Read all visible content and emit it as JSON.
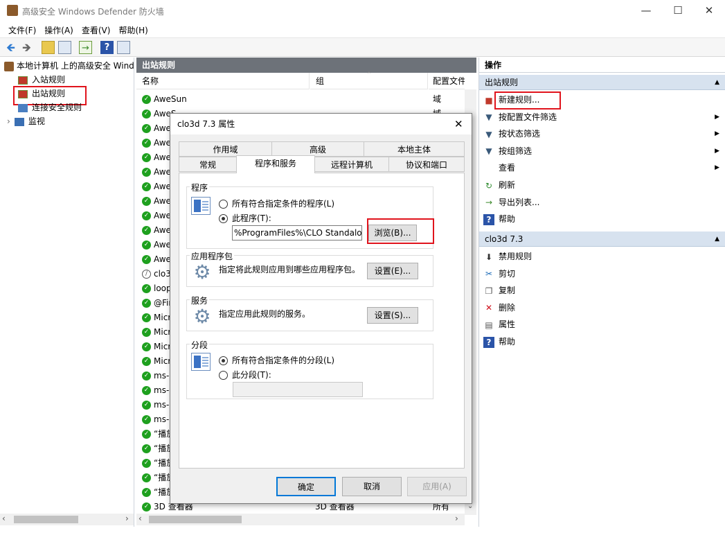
{
  "window": {
    "title": "高级安全 Windows Defender 防火墙"
  },
  "menu": [
    "文件(F)",
    "操作(A)",
    "查看(V)",
    "帮助(H)"
  ],
  "tree": {
    "root": "本地计算机 上的高级安全 Wind",
    "items": [
      "入站规则",
      "出站规则",
      "连接安全规则",
      "监视"
    ]
  },
  "middle": {
    "header": "出站规则",
    "columns": [
      "名称",
      "组",
      "配置文件"
    ],
    "rows": [
      {
        "name": "AweSun",
        "group": "",
        "profile": "域",
        "enabled": true
      },
      {
        "name": "AweS",
        "group": "",
        "profile": "域",
        "enabled": true
      },
      {
        "name": "Awe",
        "group": "",
        "profile": "",
        "enabled": true
      },
      {
        "name": "Awe",
        "group": "",
        "profile": "",
        "enabled": true
      },
      {
        "name": "Awe",
        "group": "",
        "profile": "",
        "enabled": true
      },
      {
        "name": "Awe",
        "group": "",
        "profile": "",
        "enabled": true
      },
      {
        "name": "Awe",
        "group": "",
        "profile": "",
        "enabled": true
      },
      {
        "name": "Awe",
        "group": "",
        "profile": "",
        "enabled": true
      },
      {
        "name": "Awe",
        "group": "",
        "profile": "",
        "enabled": true
      },
      {
        "name": "Awe",
        "group": "",
        "profile": "",
        "enabled": true
      },
      {
        "name": "Awe",
        "group": "",
        "profile": "",
        "enabled": true
      },
      {
        "name": "Awe",
        "group": "",
        "profile": "",
        "enabled": true
      },
      {
        "name": "clo3",
        "group": "",
        "profile": "",
        "enabled": false
      },
      {
        "name": "loop",
        "group": "",
        "profile": "",
        "enabled": true
      },
      {
        "name": "@Fir",
        "group": "",
        "profile": "",
        "enabled": true
      },
      {
        "name": "Micr",
        "group": "",
        "profile": "",
        "enabled": true
      },
      {
        "name": "Micr",
        "group": "",
        "profile": "",
        "enabled": true
      },
      {
        "name": "Micr",
        "group": "",
        "profile": "",
        "enabled": true
      },
      {
        "name": "Micr",
        "group": "",
        "profile": "",
        "enabled": true
      },
      {
        "name": "ms-r",
        "group": "",
        "profile": "",
        "enabled": true
      },
      {
        "name": "ms-r",
        "group": "",
        "profile": "",
        "enabled": true
      },
      {
        "name": "ms-r",
        "group": "",
        "profile": "",
        "enabled": true
      },
      {
        "name": "ms-r",
        "group": "",
        "profile": "",
        "enabled": true
      },
      {
        "name": "“播放",
        "group": "",
        "profile": "",
        "enabled": true
      },
      {
        "name": "“播放",
        "group": "",
        "profile": "",
        "enabled": true
      },
      {
        "name": "“播放",
        "group": "",
        "profile": "",
        "enabled": true
      },
      {
        "name": "“播放",
        "group": "",
        "profile": "",
        "enabled": true
      },
      {
        "name": "“播放",
        "group": "",
        "profile": "",
        "enabled": true
      },
      {
        "name": "3D 查看器",
        "group": "3D 查看器",
        "profile": "所有",
        "enabled": true
      }
    ]
  },
  "actions": {
    "header": "操作",
    "section1": {
      "title": "出站规则",
      "items": [
        {
          "label": "新建规则...",
          "icon": "new-rule-icon",
          "submenu": false
        },
        {
          "label": "按配置文件筛选",
          "icon": "filter-icon",
          "submenu": true
        },
        {
          "label": "按状态筛选",
          "icon": "filter-icon",
          "submenu": true
        },
        {
          "label": "按组筛选",
          "icon": "filter-icon",
          "submenu": true
        },
        {
          "label": "查看",
          "icon": "",
          "submenu": true
        },
        {
          "label": "刷新",
          "icon": "refresh-icon",
          "submenu": false
        },
        {
          "label": "导出列表...",
          "icon": "export-icon",
          "submenu": false
        },
        {
          "label": "帮助",
          "icon": "help-icon",
          "submenu": false
        }
      ]
    },
    "section2": {
      "title": "clo3d 7.3",
      "items": [
        {
          "label": "禁用规则",
          "icon": "disable-icon"
        },
        {
          "label": "剪切",
          "icon": "cut-icon"
        },
        {
          "label": "复制",
          "icon": "copy-icon"
        },
        {
          "label": "删除",
          "icon": "delete-icon"
        },
        {
          "label": "属性",
          "icon": "properties-icon"
        },
        {
          "label": "帮助",
          "icon": "help-icon"
        }
      ]
    }
  },
  "dialog": {
    "title": "clo3d 7.3 属性",
    "tabs_row1": [
      "作用域",
      "高级",
      "本地主体"
    ],
    "tabs_row2": [
      "常规",
      "程序和服务",
      "远程计算机",
      "协议和端口"
    ],
    "active_tab": "程序和服务",
    "program": {
      "label": "程序",
      "opt_all": "所有符合指定条件的程序(L)",
      "opt_this": "此程序(T):",
      "path": "%ProgramFiles%\\CLO Standalo",
      "browse": "浏览(B)..."
    },
    "package": {
      "label": "应用程序包",
      "desc": "指定将此规则应用到哪些应用程序包。",
      "button": "设置(E)..."
    },
    "services": {
      "label": "服务",
      "desc": "指定应用此规则的服务。",
      "button": "设置(S)..."
    },
    "segment": {
      "label": "分段",
      "opt_all": "所有符合指定条件的分段(L)",
      "opt_this": "此分段(T):"
    },
    "ok": "确定",
    "cancel": "取消",
    "apply": "应用(A)"
  }
}
